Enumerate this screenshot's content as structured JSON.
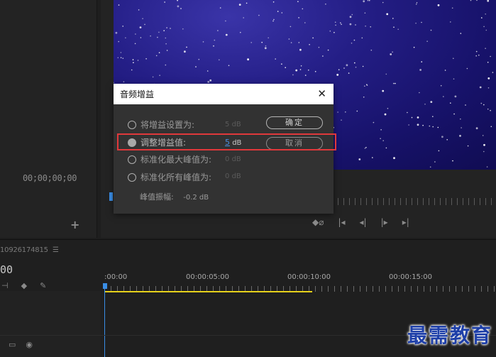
{
  "source_monitor": {
    "timecode": "00;00;00;00",
    "add_icon": "+"
  },
  "program_monitor": {
    "transport": [
      "marker-icon",
      "go-to-in-icon",
      "step-back-icon",
      "play-icon",
      "go-to-out-icon"
    ]
  },
  "timeline": {
    "sequence_name": "10926174815",
    "menu_icon": "☰",
    "current_timecode": "00",
    "ruler": [
      ":00:00",
      "00:00:05:00",
      "00:00:10:00",
      "00:00:15:00"
    ],
    "colors": {
      "workarea": "#e6d11a",
      "playhead": "#3a8ee6"
    }
  },
  "dialog": {
    "title": "音频增益",
    "close_icon": "✕",
    "options": [
      {
        "label": "将增益设置为:",
        "value": "5",
        "unit": "dB",
        "selected": false
      },
      {
        "label": "调整增益值:",
        "value": "5",
        "unit": "dB",
        "selected": true
      },
      {
        "label": "标准化最大峰值为:",
        "value": "0",
        "unit": "dB",
        "selected": false
      },
      {
        "label": "标准化所有峰值为:",
        "value": "0",
        "unit": "dB",
        "selected": false
      }
    ],
    "ok_label": "确定",
    "cancel_label": "取消",
    "peak_label": "峰值振幅:",
    "peak_value": "-0.2 dB",
    "highlight_color": "#e0383b"
  },
  "watermark": "最需教育"
}
